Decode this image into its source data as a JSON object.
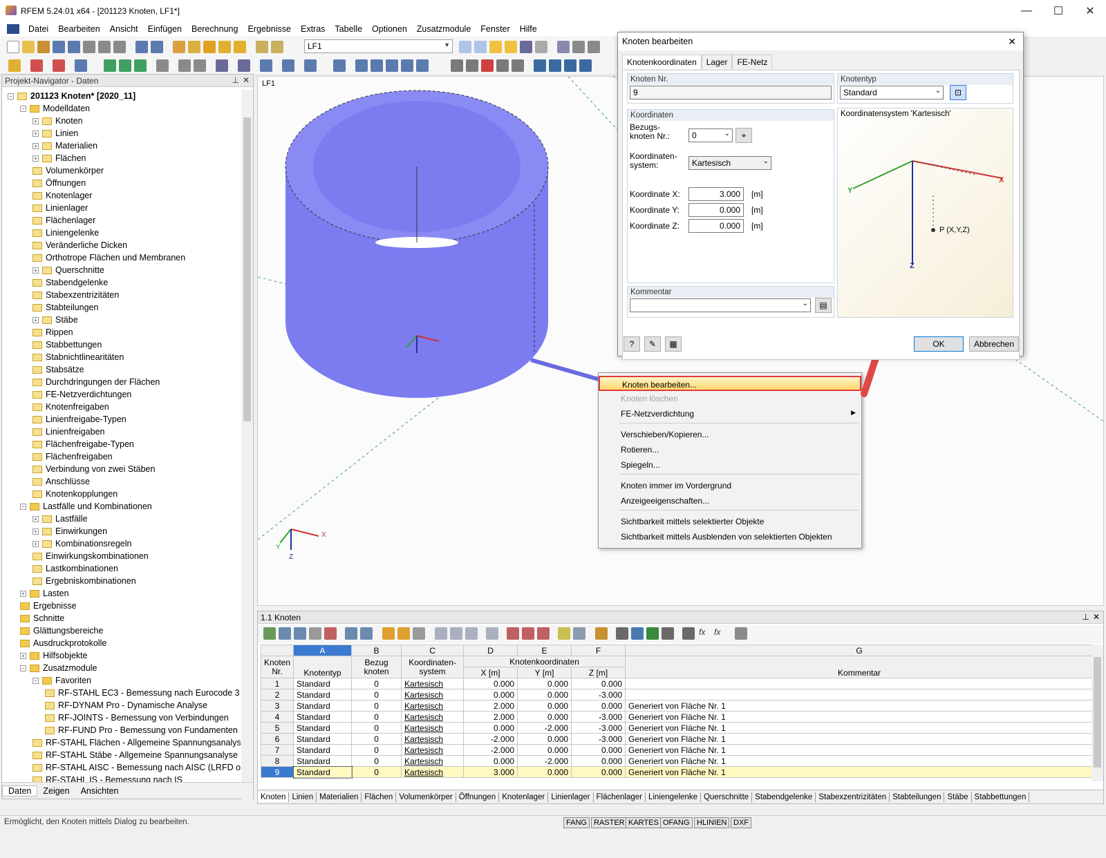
{
  "window": {
    "title": "RFEM 5.24.01 x64 - [201123 Knoten, LF1*]",
    "minimize": "—",
    "maximize": "☐",
    "close": "✕"
  },
  "menu": [
    "Datei",
    "Bearbeiten",
    "Ansicht",
    "Einfügen",
    "Berechnung",
    "Ergebnisse",
    "Extras",
    "Tabelle",
    "Optionen",
    "Zusatzmodule",
    "Fenster",
    "Hilfe"
  ],
  "toolbar": {
    "loadcase": "LF1"
  },
  "navigator": {
    "title": "Projekt-Navigator - Daten",
    "root": "201123 Knoten* [2020_11]",
    "modelldaten": "Modelldaten",
    "model_items": [
      "Knoten",
      "Linien",
      "Materialien",
      "Flächen",
      "Volumenkörper",
      "Öffnungen",
      "Knotenlager",
      "Linienlager",
      "Flächenlager",
      "Liniengelenke",
      "Veränderliche Dicken",
      "Orthotrope Flächen und Membranen",
      "Querschnitte",
      "Stabendgelenke",
      "Stabexzentrizitäten",
      "Stabteilungen",
      "Stäbe",
      "Rippen",
      "Stabbettungen",
      "Stabnichtlinearitäten",
      "Stabsätze",
      "Durchdringungen der Flächen",
      "FE-Netzverdichtungen",
      "Knotenfreigaben",
      "Linienfreigabe-Typen",
      "Linienfreigaben",
      "Flächenfreigabe-Typen",
      "Flächenfreigaben",
      "Verbindung von zwei Stäben",
      "Anschlüsse",
      "Knotenkopplungen"
    ],
    "lastfaelle": "Lastfälle und Kombinationen",
    "load_items": [
      "Lastfälle",
      "Einwirkungen",
      "Kombinationsregeln",
      "Einwirkungskombinationen",
      "Lastkombinationen",
      "Ergebniskombinationen"
    ],
    "top_items": [
      "Lasten",
      "Ergebnisse",
      "Schnitte",
      "Glättungsbereiche",
      "Ausdruckprotokolle",
      "Hilfsobjekte",
      "Zusatzmodule"
    ],
    "favoriten": "Favoriten",
    "fav_items": [
      "RF-STAHL EC3 - Bemessung nach Eurocode 3",
      "RF-DYNAM Pro - Dynamische Analyse",
      "RF-JOINTS - Bemessung von Verbindungen",
      "RF-FUND Pro - Bemessung von Fundamenten"
    ],
    "module_items": [
      "RF-STAHL Flächen - Allgemeine Spannungsanalyse",
      "RF-STAHL Stäbe - Allgemeine Spannungsanalyse",
      "RF-STAHL AISC - Bemessung nach AISC (LRFD od",
      "RF-STAHL IS - Bemessung nach IS"
    ],
    "tabs": [
      "Daten",
      "Zeigen",
      "Ansichten"
    ]
  },
  "viewport": {
    "label": "LF1",
    "axis_x": "X",
    "axis_y": "Y",
    "axis_z": "Z"
  },
  "dialog": {
    "title": "Knoten bearbeiten",
    "tabs": [
      "Knotenkoordinaten",
      "Lager",
      "FE-Netz"
    ],
    "knoten_nr_label": "Knoten Nr.",
    "knoten_nr": "9",
    "knotentyp_label": "Knotentyp",
    "knotentyp": "Standard",
    "koordinaten_label": "Koordinaten",
    "bezug_label": "Bezugs-\nknoten Nr.:",
    "bezug": "0",
    "ksys_label": "Koordinaten-\nsystem:",
    "ksys": "Kartesisch",
    "x_label": "Koordinate X:",
    "x": "3.000",
    "y_label": "Koordinate Y:",
    "y": "0.000",
    "z_label": "Koordinate Z:",
    "z": "0.000",
    "unit": "[m]",
    "kommentar_label": "Kommentar",
    "preview_title": "Koordinatensystem 'Kartesisch'",
    "preview_point": "P (X,Y,Z)",
    "ok": "OK",
    "cancel": "Abbrechen"
  },
  "context_menu": [
    {
      "label": "Knoten bearbeiten...",
      "enabled": true
    },
    {
      "label": "Knoten löschen",
      "enabled": false
    },
    {
      "label": "FE-Netzverdichtung",
      "enabled": true
    },
    {
      "label": "Verschieben/Kopieren...",
      "enabled": true
    },
    {
      "label": "Rotieren...",
      "enabled": true
    },
    {
      "label": "Spiegeln...",
      "enabled": true
    },
    {
      "label": "Knoten immer im Vordergrund",
      "enabled": true
    },
    {
      "label": "Anzeigeeigenschaften...",
      "enabled": true
    },
    {
      "label": "Sichtbarkeit mittels selektierter Objekte",
      "enabled": true
    },
    {
      "label": "Sichtbarkeit mittels Ausblenden von selektierten Objekten",
      "enabled": true
    }
  ],
  "table": {
    "title": "1.1 Knoten",
    "col_letters": [
      "A",
      "B",
      "C",
      "D",
      "E",
      "F",
      "G"
    ],
    "col_headers": [
      "Knoten\nNr.",
      "Knotentyp",
      "Bezug\nknoten",
      "Koordinaten-\nsystem",
      "X [m]",
      "Y [m]",
      "Z [m]",
      "Kommentar"
    ],
    "group_header": "Knotenkoordinaten",
    "rows": [
      [
        "1",
        "Standard",
        "0",
        "Kartesisch",
        "0.000",
        "0.000",
        "0.000",
        ""
      ],
      [
        "2",
        "Standard",
        "0",
        "Kartesisch",
        "0.000",
        "0.000",
        "-3.000",
        ""
      ],
      [
        "3",
        "Standard",
        "0",
        "Kartesisch",
        "2.000",
        "0.000",
        "0.000",
        "Generiert von Fläche Nr. 1"
      ],
      [
        "4",
        "Standard",
        "0",
        "Kartesisch",
        "2.000",
        "0.000",
        "-3.000",
        "Generiert von Fläche Nr. 1"
      ],
      [
        "5",
        "Standard",
        "0",
        "Kartesisch",
        "0.000",
        "-2.000",
        "-3.000",
        "Generiert von Fläche Nr. 1"
      ],
      [
        "6",
        "Standard",
        "0",
        "Kartesisch",
        "-2.000",
        "0.000",
        "-3.000",
        "Generiert von Fläche Nr. 1"
      ],
      [
        "7",
        "Standard",
        "0",
        "Kartesisch",
        "-2.000",
        "0.000",
        "0.000",
        "Generiert von Fläche Nr. 1"
      ],
      [
        "8",
        "Standard",
        "0",
        "Kartesisch",
        "0.000",
        "-2.000",
        "0.000",
        "Generiert von Fläche Nr. 1"
      ],
      [
        "9",
        "Standard",
        "0",
        "Kartesisch",
        "3.000",
        "0.000",
        "0.000",
        "Generiert von Fläche Nr. 1"
      ]
    ],
    "bottom_tabs": [
      "Knoten",
      "Linien",
      "Materialien",
      "Flächen",
      "Volumenkörper",
      "Öffnungen",
      "Knotenlager",
      "Linienlager",
      "Flächenlager",
      "Liniengelenke",
      "Querschnitte",
      "Stabendgelenke",
      "Stabexzentrizitäten",
      "Stabteilungen",
      "Stäbe",
      "Stabbettungen"
    ]
  },
  "status": {
    "text": "Ermöglicht, den Knoten mittels Dialog zu bearbeiten.",
    "buttons": [
      "FANG",
      "RASTER",
      "KARTES",
      "OFANG",
      "HLINIEN",
      "DXF"
    ]
  },
  "colors": {
    "cylinder": "#7c7cf0",
    "highlight": "#e03c3c",
    "selected_row": "#fff8c0"
  }
}
